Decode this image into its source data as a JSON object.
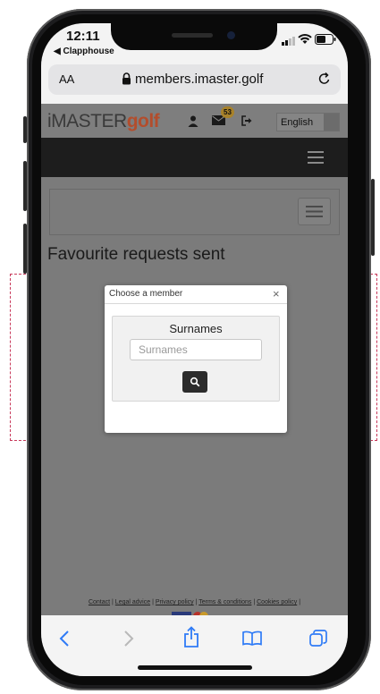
{
  "status_bar": {
    "time": "12:11",
    "back_app": "◀ Clapphouse"
  },
  "safari": {
    "text_size_label": "AA",
    "url": "members.imaster.golf"
  },
  "site_header": {
    "logo_left": "iMASTER",
    "logo_right": "golf",
    "mail_badge": "53",
    "language": "English"
  },
  "page": {
    "title": "Favourite requests sent"
  },
  "modal": {
    "title": "Choose a member",
    "close": "×",
    "field_label": "Surnames",
    "input_placeholder": "Surnames"
  },
  "footer": {
    "links": [
      "Contact",
      "Legal advice",
      "Privacy policy",
      "Terms & conditions",
      "Cookies policy"
    ],
    "separator": "|"
  },
  "colors": {
    "brand_orange": "#e0623a",
    "overlay_gray": "#7b7b7b",
    "highlight_dash": "#c8385a",
    "badge_gold": "#e0b02a"
  }
}
